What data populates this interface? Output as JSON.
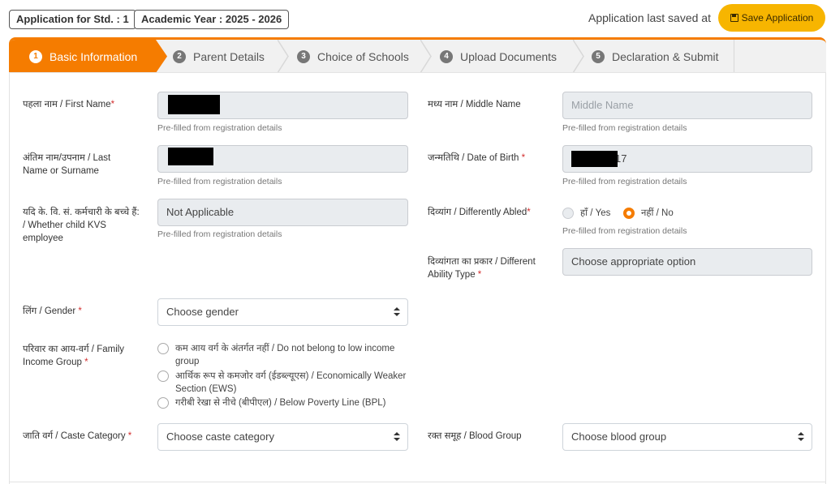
{
  "header": {
    "std_label": "Application for Std. : ",
    "std_value": "1",
    "year_label": "Academic Year : ",
    "year_value": "2025 - 2026",
    "saved_text": "Application last saved at",
    "save_button": "Save Application"
  },
  "tabs": [
    {
      "num": "1",
      "label": "Basic Information",
      "active": true
    },
    {
      "num": "2",
      "label": "Parent Details"
    },
    {
      "num": "3",
      "label": "Choice of Schools"
    },
    {
      "num": "4",
      "label": "Upload Documents"
    },
    {
      "num": "5",
      "label": "Declaration & Submit"
    }
  ],
  "form": {
    "first_name_label": "पहला नाम / First Name",
    "middle_name_label": "मध्य नाम / Middle Name",
    "middle_name_placeholder": "Middle Name",
    "last_name_label": "अंतिम नाम/उपनाम / Last Name or Surname",
    "dob_label": "जन्मतिथि / Date of Birth ",
    "dob_visible_suffix": "17",
    "kvs_label": "यदि के. वि. सं. कर्मचारी के बच्चे हैं: / Whether child KVS employee",
    "kvs_value": "Not Applicable",
    "disabled_label": "दिव्यांग / Differently Abled",
    "disabled_yes": "हाँ / Yes",
    "disabled_no": "नहीं / No",
    "ability_type_label": "दिव्यांगता का प्रकार / Different Ability Type ",
    "ability_type_value": "Choose appropriate option",
    "gender_label": "लिंग / Gender ",
    "gender_value": "Choose gender",
    "income_label": "परिवार का आय-वर्ग / Family Income Group ",
    "income_options": [
      "कम आय वर्ग के अंतर्गत नहीं / Do not belong to low income group",
      "आर्थिक रूप से कमजोर वर्ग (ईडब्ल्यूएस) / Economically Weaker Section (EWS)",
      "गरीबी रेखा से नीचे (बीपीएल) / Below Poverty Line (BPL)"
    ],
    "caste_label": "जाति वर्ग / Caste Category ",
    "caste_value": "Choose caste category",
    "blood_label": "रक्त समूह / Blood Group",
    "blood_value": "Choose blood group",
    "prefilled_help": "Pre-filled from registration details",
    "required_mark": "*"
  }
}
